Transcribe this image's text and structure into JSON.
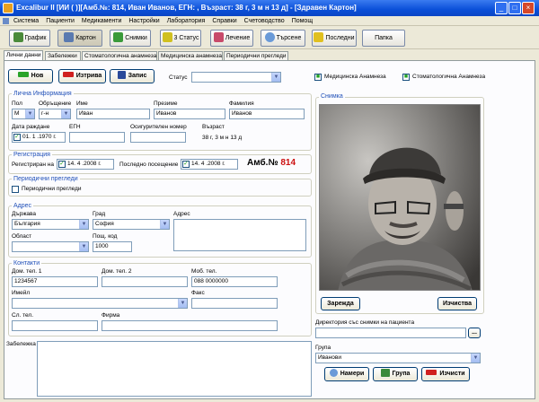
{
  "window": {
    "title": "Excalibur II [ИИ ( )][Амб.№: 814, Иван Иванов, ЕГН: , Възраст: 38 г, 3 м н 13 д] - [Здравен Картон]"
  },
  "menu": [
    "Система",
    "Пациенти",
    "Медикаменти",
    "Настройки",
    "Лаборатория",
    "Справки",
    "Счетоводство",
    "Помощ"
  ],
  "toolbar": {
    "grafik": "График",
    "karton": "Картон",
    "snimki": "Снимки",
    "status": "3 Статус",
    "lechenie": "Лечение",
    "tarsene": "Търсене",
    "poslednii": "Последни",
    "papka": "Папка"
  },
  "tabs": [
    "Лични данни",
    "Забележки",
    "Стоматологична анамнеза",
    "Медицинска анамнеза",
    "Периодични прегледи"
  ],
  "actions": {
    "new": "Нов",
    "delete": "Изтрива",
    "save": "Запис",
    "status_label": "Статус",
    "status_value": "",
    "med_anamnesis": "Медицинска Анамнеза",
    "stom_anamnesis": "Стоматологична Анамнеза"
  },
  "personal": {
    "group_title": "Лична Информация",
    "sex_label": "Пол",
    "sex_value": "М",
    "address_label": "Обръщение",
    "address_value": "г-н",
    "first_label": "Име",
    "first_value": "Иван",
    "middle_label": "Презиме",
    "middle_value": "Иванов",
    "last_label": "Фамилия",
    "last_value": "Иванов",
    "dob_label": "Дата раждане",
    "dob_value": "01. 1 .1970 г.",
    "egn_label": "ЕГН",
    "egn_value": "",
    "insurance_label": "Осигурителен номер",
    "insurance_value": "",
    "age_label": "Възраст",
    "age_value": "38 г, 3 м н 13 д"
  },
  "registration": {
    "group_title": "Регистрация",
    "reg_label": "Регистриран на",
    "reg_value": "14. 4 .2008 г.",
    "last_label": "Последно посещение",
    "last_value": "14. 4 .2008 г.",
    "amb_label": "Амб.№",
    "amb_value": "814"
  },
  "periodic": {
    "group_title": "Периодични прегледи",
    "check_label": "Периодични прегледи"
  },
  "addr": {
    "group_title": "Адрес",
    "country_label": "Държава",
    "country_value": "България",
    "city_label": "Град",
    "city_value": "София",
    "address_label": "Адрес",
    "address_value": "",
    "region_label": "Област",
    "region_value": "",
    "zip_label": "Пощ. код",
    "zip_value": "1000"
  },
  "contacts": {
    "group_title": "Контакти",
    "phone1_label": "Дом. тел. 1",
    "phone1_value": "1234567",
    "phone2_label": "Дом. тел. 2",
    "phone2_value": "",
    "mobile_label": "Моб. тел.",
    "mobile_value": "088 0000000",
    "email_label": "Имейл",
    "email_value": "",
    "fax_label": "Факс",
    "fax_value": "",
    "work_label": "Сл. тел.",
    "work_value": "",
    "company_label": "Фирма",
    "company_value": ""
  },
  "notes": {
    "label": "Забележка",
    "value": ""
  },
  "photo": {
    "group_title": "Снимка",
    "load": "Зарежда",
    "clear": "Изчиства"
  },
  "photo_dir": {
    "label": "Директория със снимки на пациента",
    "value": "",
    "browse": "..."
  },
  "group": {
    "label": "Група",
    "value": "Иванови",
    "find": "Намери",
    "group_btn": "Група",
    "clear": "Изчисти"
  },
  "colors": {
    "accent": "#2050b8",
    "amb": "#cc1010",
    "title": "#0a4fd8"
  }
}
